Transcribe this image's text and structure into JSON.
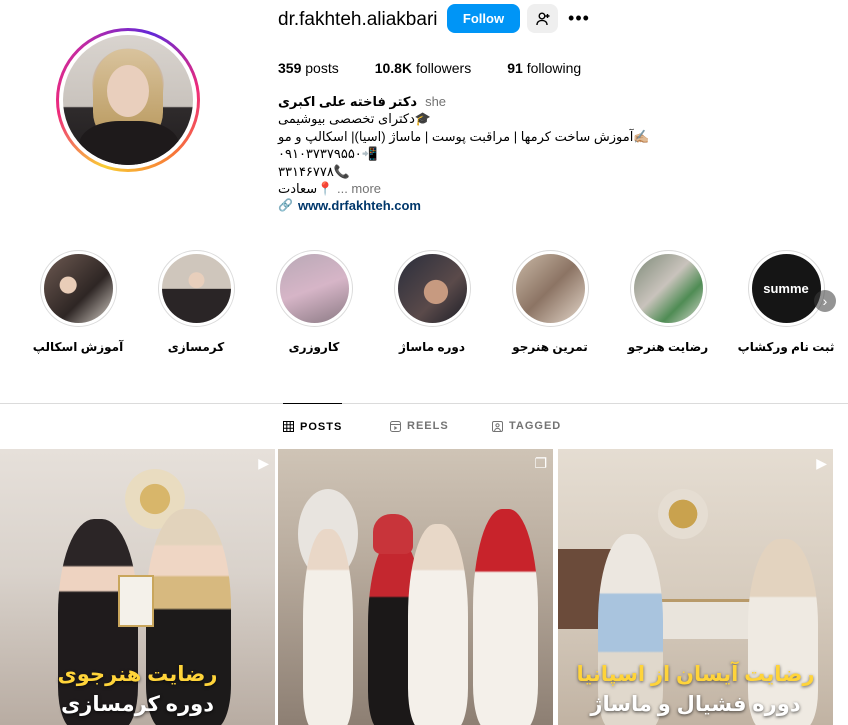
{
  "profile": {
    "username": "dr.fakhteh.aliakbari",
    "follow_label": "Follow",
    "posts_count": "359",
    "posts_label": "posts",
    "followers_count": "10.8K",
    "followers_label": "followers",
    "following_count": "91",
    "following_label": "following",
    "full_name": "دکتر فاخته علی اکبری",
    "pronoun": "she",
    "bio_lines": [
      "🎓دکترای تخصصی بیوشیمی",
      "✍🏼آموزش ساخت کرمها | مراقبت پوست | ماساژ (اسیا)| اسکالپ و مو",
      "۰۹۱۰۳۷۳۷۹۵۵۰📲",
      "۳۳۱۴۶۷۷۸📞",
      "📍سعادت"
    ],
    "bio_more": "... more",
    "website": "www.drfakhteh.com"
  },
  "highlights": [
    {
      "label": "آموزش اسکالپ",
      "icon": "highlight-image"
    },
    {
      "label": "کرمسازی",
      "icon": "highlight-image"
    },
    {
      "label": "کاروزری",
      "icon": "highlight-image"
    },
    {
      "label": "دوره ماساژ",
      "icon": "highlight-image"
    },
    {
      "label": "تمرین هنرجو",
      "icon": "highlight-image"
    },
    {
      "label": "رضایت هنرجو",
      "icon": "highlight-image"
    },
    {
      "label": "ثبت نام ورکشاپ",
      "icon": "highlight-image",
      "cover_text": "summe"
    }
  ],
  "tabs": [
    {
      "label": "POSTS",
      "icon": "grid-icon",
      "active": true
    },
    {
      "label": "REELS",
      "icon": "reels-icon",
      "active": false
    },
    {
      "label": "TAGGED",
      "icon": "tag-icon",
      "active": false
    }
  ],
  "posts": [
    {
      "caption_top": "رضایت هنرجوی",
      "caption_bottom": "دوره کرمسازی",
      "type": "reel"
    },
    {
      "caption_top": "",
      "caption_bottom": "",
      "type": "carousel"
    },
    {
      "caption_top": "رضایت آیسان از اسپانیا",
      "caption_bottom": "دوره فشیال و ماساژ",
      "type": "reel"
    }
  ],
  "colors": {
    "accent": "#0095f6",
    "caption_yellow": "#ffd43a"
  }
}
